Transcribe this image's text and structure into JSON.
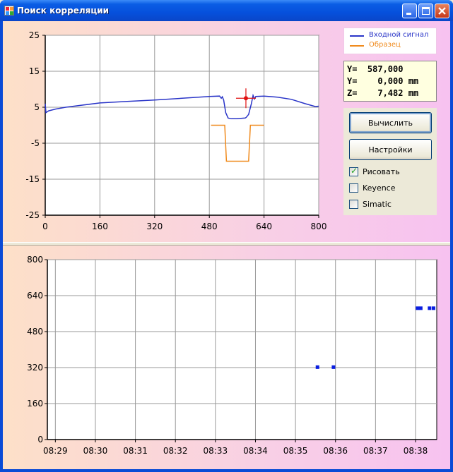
{
  "window": {
    "title": "Поиск корреляции"
  },
  "top_chart": {
    "legend": {
      "input_signal": {
        "label": "Входной сигнал",
        "color": "#2a35c8"
      },
      "sample": {
        "label": "Образец",
        "color": "#f08a1c"
      }
    }
  },
  "readout": {
    "line_y1": "Y=  587,000",
    "line_y2": "Y=    0,000 mm",
    "line_z": "Z=    7,482 mm"
  },
  "controls": {
    "calculate_label": "Вычислить",
    "settings_label": "Настройки",
    "draw": {
      "label": "Рисовать",
      "checked": true
    },
    "keyence": {
      "label": "Keyence",
      "checked": false
    },
    "simatic": {
      "label": "Simatic",
      "checked": false
    }
  },
  "chart_data": [
    {
      "type": "line",
      "xlim": [
        0,
        800
      ],
      "ylim": [
        -25,
        25
      ],
      "xticks": [
        "0",
        "160",
        "320",
        "480",
        "640",
        "800"
      ],
      "yticks": [
        "25",
        "15",
        "5",
        "-5",
        "-15",
        "-25"
      ],
      "grid": true,
      "legend_position": "top-right",
      "series": [
        {
          "name": "Входной сигнал",
          "color": "#2a35c8",
          "points": [
            [
              0,
              6
            ],
            [
              2,
              3.5
            ],
            [
              10,
              4
            ],
            [
              30,
              4.5
            ],
            [
              60,
              5
            ],
            [
              100,
              5.5
            ],
            [
              160,
              6.2
            ],
            [
              240,
              6.6
            ],
            [
              320,
              7.0
            ],
            [
              400,
              7.5
            ],
            [
              480,
              8.0
            ],
            [
              510,
              8.1
            ],
            [
              515,
              7.5
            ],
            [
              518,
              7.9
            ],
            [
              522,
              7.0
            ],
            [
              528,
              3.5
            ],
            [
              535,
              2.0
            ],
            [
              545,
              1.8
            ],
            [
              560,
              1.8
            ],
            [
              585,
              2.0
            ],
            [
              588,
              2.2
            ],
            [
              595,
              3.0
            ],
            [
              603,
              6.0
            ],
            [
              608,
              8.3
            ],
            [
              612,
              7.3
            ],
            [
              616,
              8.0
            ],
            [
              640,
              8.1
            ],
            [
              680,
              7.8
            ],
            [
              720,
              7.2
            ],
            [
              760,
              6.0
            ],
            [
              790,
              5.2
            ],
            [
              800,
              5.3
            ]
          ]
        },
        {
          "name": "Образец",
          "color": "#f08a1c",
          "points": [
            [
              485,
              0
            ],
            [
              525,
              0
            ],
            [
              530,
              -10
            ],
            [
              595,
              -10
            ],
            [
              600,
              0
            ],
            [
              640,
              0
            ]
          ]
        }
      ],
      "marker": {
        "x": 587,
        "y": 7.5,
        "color": "#e01010"
      }
    },
    {
      "type": "scatter",
      "ylim": [
        0,
        800
      ],
      "yticks": [
        "800",
        "640",
        "480",
        "320",
        "160",
        "0"
      ],
      "xticks": [
        "08:29",
        "08:30",
        "08:31",
        "08:32",
        "08:33",
        "08:34",
        "08:35",
        "08:36",
        "08:37",
        "08:38"
      ],
      "xlim_minutes": [
        28.8,
        38.53
      ],
      "grid": true,
      "series": [
        {
          "color": "#0a1ee0",
          "points": [
            [
              35.55,
              322
            ],
            [
              35.95,
              322
            ],
            [
              38.05,
              584
            ],
            [
              38.13,
              584
            ],
            [
              38.35,
              584
            ],
            [
              38.45,
              584
            ]
          ]
        }
      ]
    }
  ]
}
